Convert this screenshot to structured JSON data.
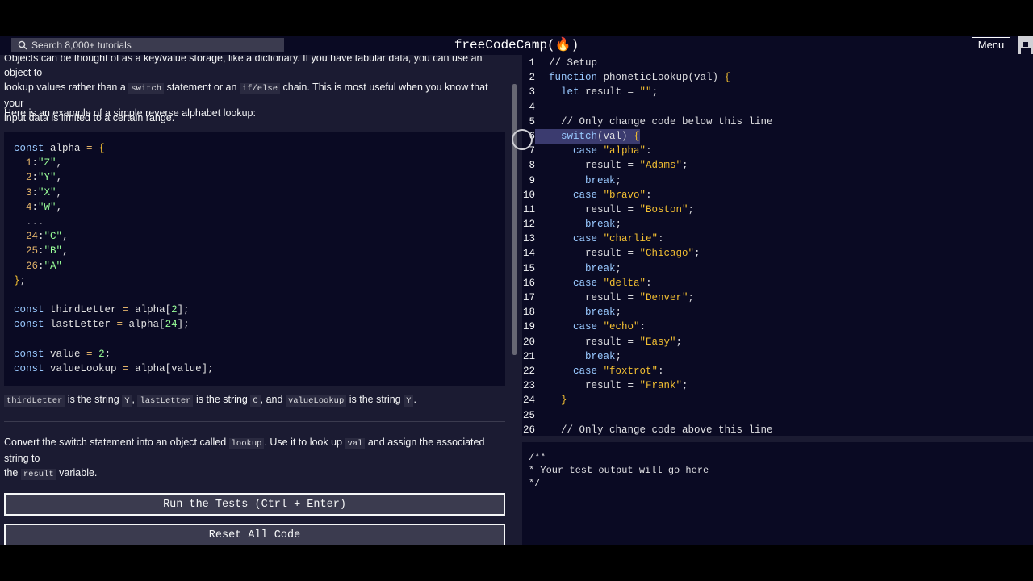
{
  "navbar": {
    "search_placeholder": "Search 8,000+ tutorials",
    "brand": "freeCodeCamp(🔥)",
    "menu_label": "Menu"
  },
  "lesson": {
    "intro_l1": "Objects can be thought of as a key/value storage, like a dictionary. If you have tabular data, you can use an object to",
    "intro_l2a": "lookup values rather than a ",
    "intro_code1": "switch",
    "intro_l2b": " statement or an ",
    "intro_code2": "if/else",
    "intro_l2c": " chain. This is most useful when you know that your",
    "intro_l3": "input data is limited to a certain range.",
    "example_intro": "Here is an example of a simple reverse alphabet lookup:",
    "example_lines": [
      [
        "const",
        " alpha ",
        "=",
        " ",
        "{",
        "",
        ""
      ],
      [
        "",
        "  ",
        "1",
        ":",
        "\"Z\"",
        ",",
        ""
      ],
      [
        "",
        "  ",
        "2",
        ":",
        "\"Y\"",
        ",",
        ""
      ],
      [
        "",
        "  ",
        "3",
        ":",
        "\"X\"",
        ",",
        ""
      ],
      [
        "",
        "  ",
        "4",
        ":",
        "\"W\"",
        ",",
        ""
      ],
      [
        "",
        "  ...",
        "",
        "",
        "",
        "",
        ""
      ],
      [
        "",
        "  ",
        "24",
        ":",
        "\"C\"",
        ",",
        ""
      ],
      [
        "",
        "  ",
        "25",
        ":",
        "\"B\"",
        ",",
        ""
      ],
      [
        "",
        "  ",
        "26",
        ":",
        "\"A\"",
        "",
        ""
      ],
      [
        "",
        "",
        "",
        "",
        "}",
        ";",
        ""
      ],
      [
        "",
        "",
        "",
        "",
        "",
        "",
        ""
      ],
      [
        "const",
        " thirdLetter ",
        "=",
        " alpha[",
        "2",
        "];",
        ""
      ],
      [
        "const",
        " lastLetter ",
        "=",
        " alpha[",
        "24",
        "];",
        ""
      ],
      [
        "",
        "",
        "",
        "",
        "",
        "",
        ""
      ],
      [
        "const",
        " value ",
        "=",
        " ",
        "2",
        ";",
        ""
      ],
      [
        "const",
        " valueLookup ",
        "=",
        " alpha[value];",
        "",
        "",
        ""
      ]
    ],
    "summary_code1": "thirdLetter",
    "summary_t1": " is the string ",
    "summary_code2": "Y",
    "summary_t2": ", ",
    "summary_code3": "lastLetter",
    "summary_t3": " is the string ",
    "summary_code4": "C",
    "summary_t4": ", and ",
    "summary_code5": "valueLookup",
    "summary_t5": " is the string ",
    "summary_code6": "Y",
    "summary_t6": ".",
    "task_a": "Convert the switch statement into an object called ",
    "task_code1": "lookup",
    "task_b": ". Use it to look up ",
    "task_code2": "val",
    "task_c": " and assign the associated string to",
    "task_d": "the ",
    "task_code3": "result",
    "task_e": " variable.",
    "run_button": "Run the Tests (Ctrl + Enter)",
    "reset_button": "Reset All Code"
  },
  "editor": {
    "lines": [
      {
        "n": "1",
        "t": "// Setup"
      },
      {
        "n": "2",
        "t": "function phoneticLookup(val) {"
      },
      {
        "n": "3",
        "t": "  let result = \"\";"
      },
      {
        "n": "4",
        "t": ""
      },
      {
        "n": "5",
        "t": "  // Only change code below this line"
      },
      {
        "n": "6",
        "t": "  switch(val) {"
      },
      {
        "n": "7",
        "t": "    case \"alpha\":"
      },
      {
        "n": "8",
        "t": "      result = \"Adams\";"
      },
      {
        "n": "9",
        "t": "      break;"
      },
      {
        "n": "10",
        "t": "    case \"bravo\":"
      },
      {
        "n": "11",
        "t": "      result = \"Boston\";"
      },
      {
        "n": "12",
        "t": "      break;"
      },
      {
        "n": "13",
        "t": "    case \"charlie\":"
      },
      {
        "n": "14",
        "t": "      result = \"Chicago\";"
      },
      {
        "n": "15",
        "t": "      break;"
      },
      {
        "n": "16",
        "t": "    case \"delta\":"
      },
      {
        "n": "17",
        "t": "      result = \"Denver\";"
      },
      {
        "n": "18",
        "t": "      break;"
      },
      {
        "n": "19",
        "t": "    case \"echo\":"
      },
      {
        "n": "20",
        "t": "      result = \"Easy\";"
      },
      {
        "n": "21",
        "t": "      break;"
      },
      {
        "n": "22",
        "t": "    case \"foxtrot\":"
      },
      {
        "n": "23",
        "t": "      result = \"Frank\";"
      },
      {
        "n": "24",
        "t": "  }"
      },
      {
        "n": "25",
        "t": ""
      },
      {
        "n": "26",
        "t": "  // Only change code above this line"
      }
    ]
  },
  "output": {
    "lines": [
      "/**",
      "* Your test output will go here",
      "*/"
    ]
  }
}
